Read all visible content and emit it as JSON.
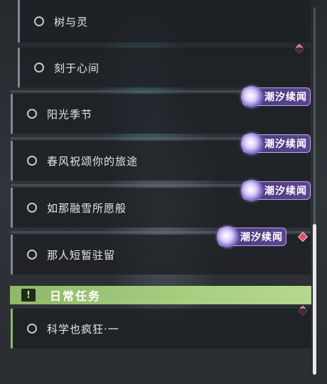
{
  "quests": [
    {
      "title": "树与灵"
    },
    {
      "title": "刻于心间"
    },
    {
      "title": "阳光季节"
    },
    {
      "title": "春风祝颂你的旅途"
    },
    {
      "title": "如那融雪所愿般"
    },
    {
      "title": "那人短暂驻留"
    }
  ],
  "badge_label": "潮汐续闻",
  "daily_section": {
    "title": "日常任务",
    "icon": "!",
    "quests": [
      {
        "title": "科学也疯狂·一"
      }
    ]
  },
  "colors": {
    "badge_bg": "#5b4590",
    "section_bg": "#a7cf80",
    "diamond": "#e0506a",
    "story_border": "#7d8a93",
    "daily_border": "#8fb86a"
  }
}
